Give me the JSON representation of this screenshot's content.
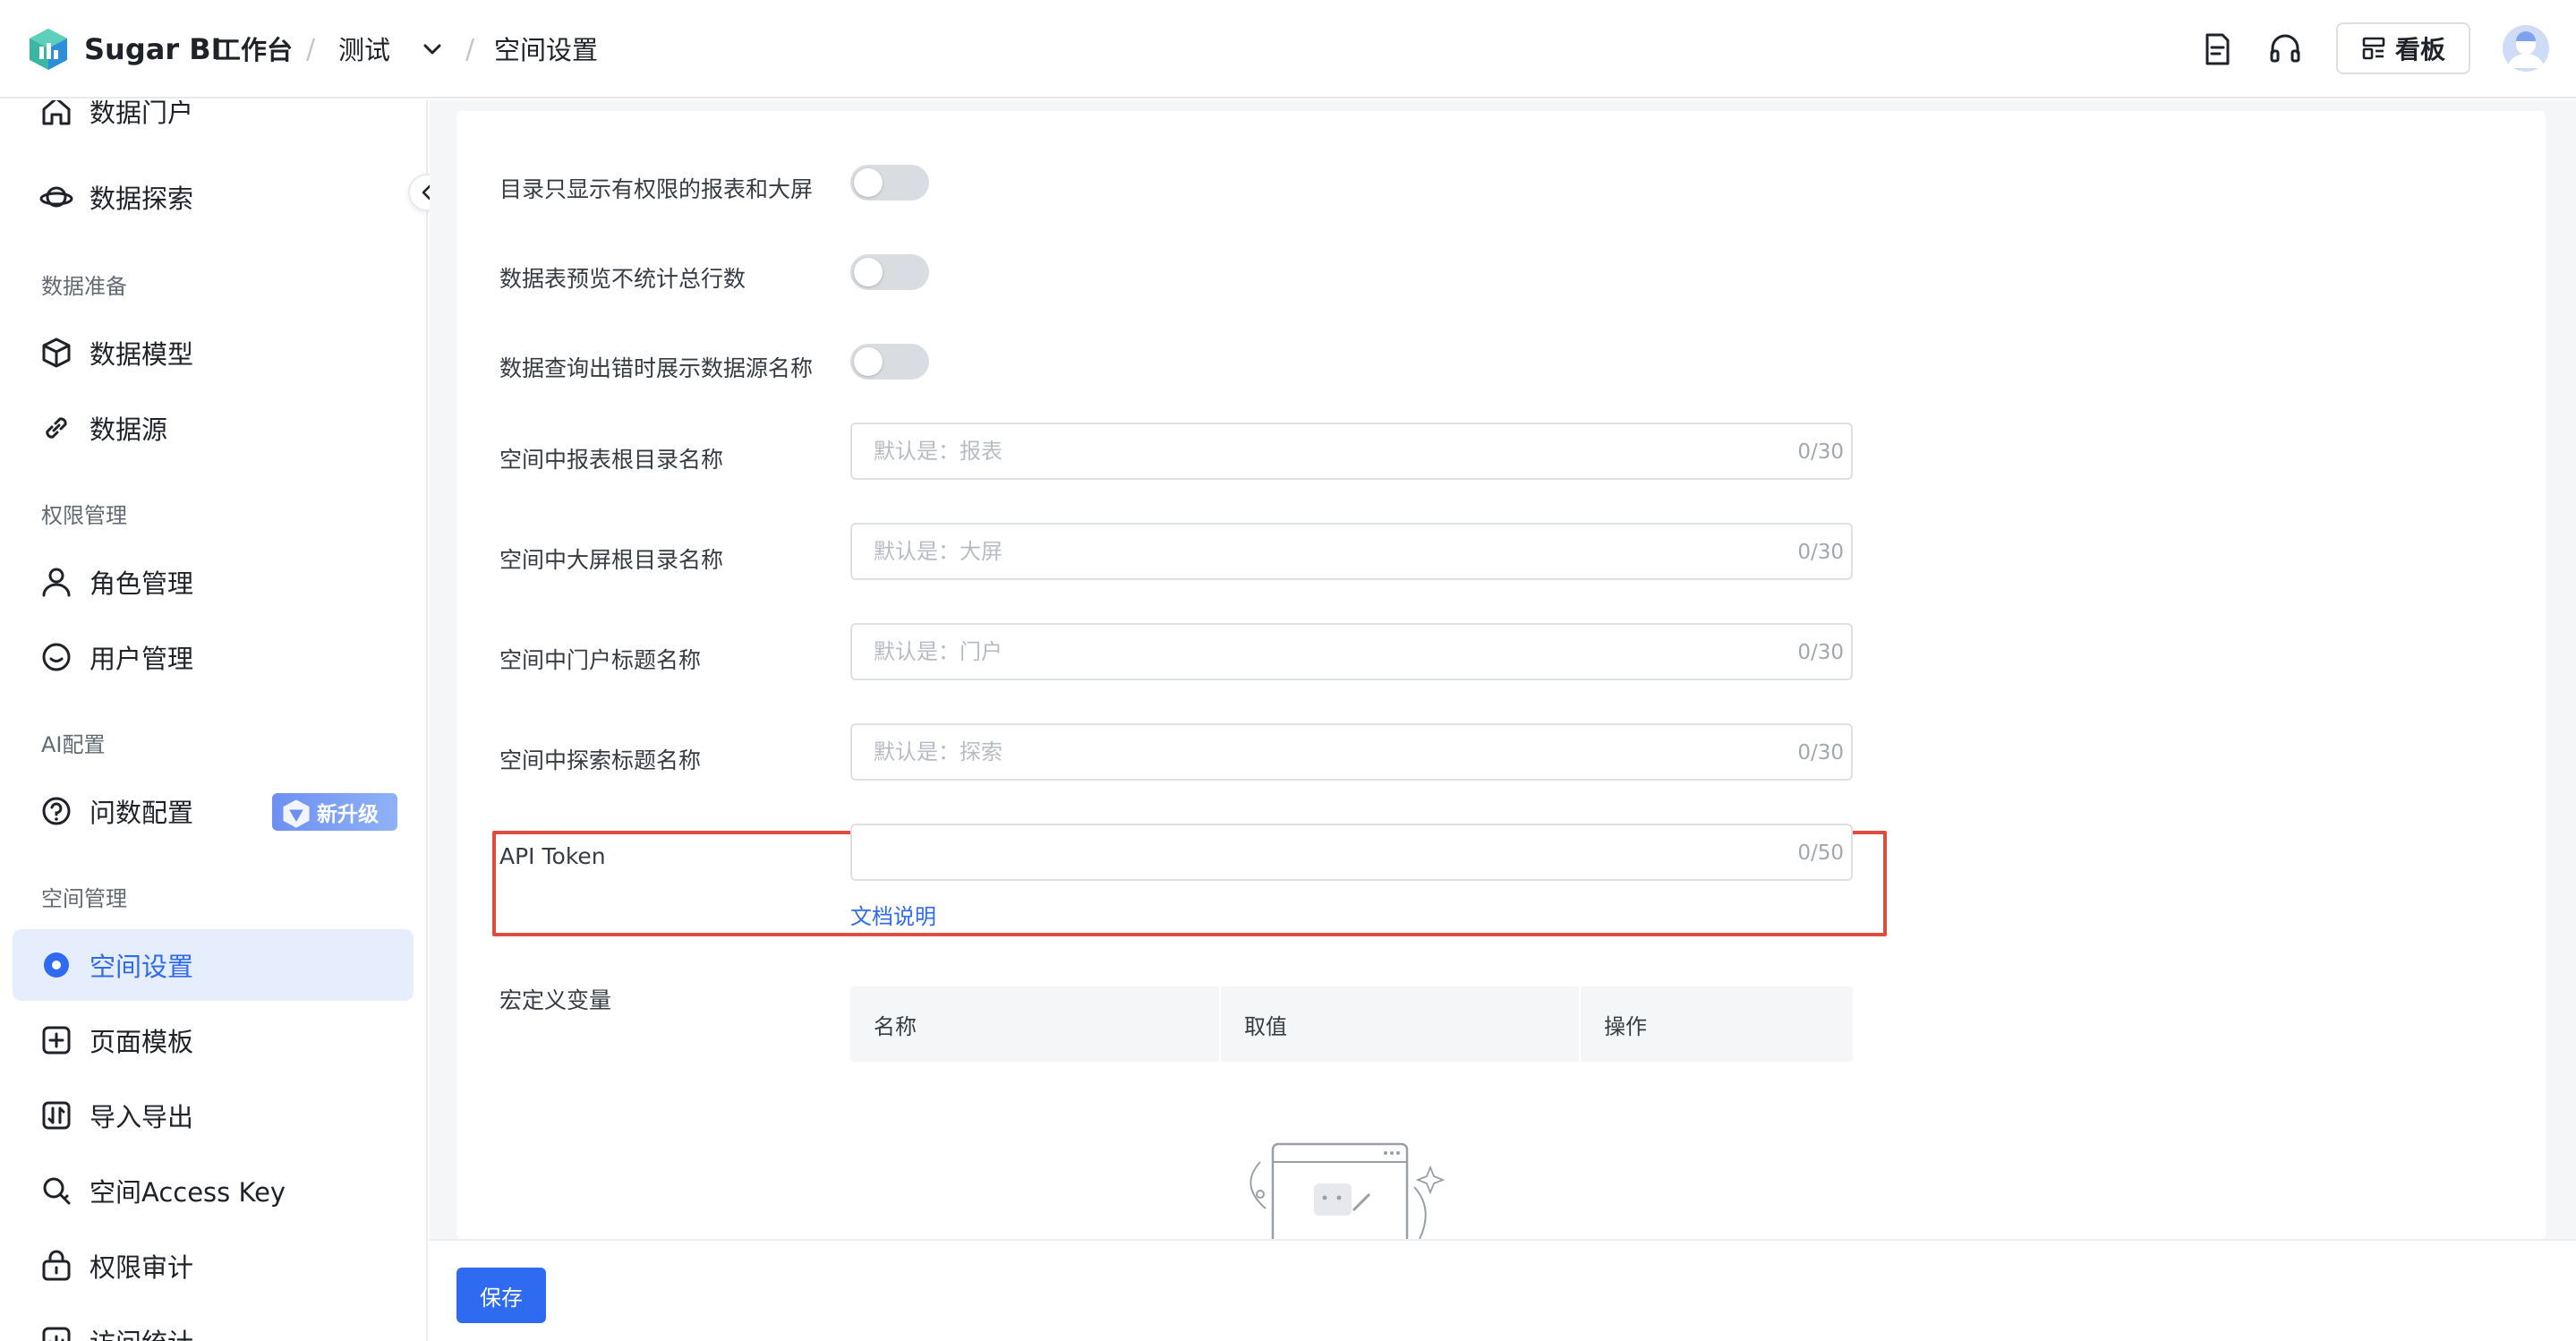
{
  "header": {
    "brand": "Sugar BI",
    "workbench": "工作台",
    "separator": "/",
    "workspace": "测试",
    "page": "空间设置",
    "board_label": "看板"
  },
  "sidebar": {
    "items": [
      {
        "label": "数据门户",
        "icon": "home-icon"
      },
      {
        "label": "数据探索",
        "icon": "planet-icon"
      },
      {
        "group": "数据准备"
      },
      {
        "label": "数据模型",
        "icon": "cube-icon"
      },
      {
        "label": "数据源",
        "icon": "link-icon"
      },
      {
        "group": "权限管理"
      },
      {
        "label": "角色管理",
        "icon": "user-icon"
      },
      {
        "label": "用户管理",
        "icon": "user-circle-icon"
      },
      {
        "group": "AI配置"
      },
      {
        "label": "问数配置",
        "icon": "question-icon",
        "badge": "新升级"
      },
      {
        "group": "空间管理"
      },
      {
        "label": "空间设置",
        "icon": "settings-icon",
        "active": true
      },
      {
        "label": "页面模板",
        "icon": "template-icon"
      },
      {
        "label": "导入导出",
        "icon": "import-export-icon"
      },
      {
        "label": "空间Access Key",
        "icon": "key-icon"
      },
      {
        "label": "权限审计",
        "icon": "audit-icon"
      },
      {
        "label": "访问统计",
        "icon": "stats-icon"
      }
    ]
  },
  "settings": {
    "toggles": [
      {
        "label": "目录只显示有权限的报表和大屏",
        "on": false
      },
      {
        "label": "数据表预览不统计总行数",
        "on": false
      },
      {
        "label": "数据查询出错时展示数据源名称",
        "on": false
      }
    ],
    "inputs": [
      {
        "label": "空间中报表根目录名称",
        "placeholder": "默认是：报表",
        "value": "",
        "counter": "0/30"
      },
      {
        "label": "空间中大屏根目录名称",
        "placeholder": "默认是：大屏",
        "value": "",
        "counter": "0/30"
      },
      {
        "label": "空间中门户标题名称",
        "placeholder": "默认是：门户",
        "value": "",
        "counter": "0/30"
      },
      {
        "label": "空间中探索标题名称",
        "placeholder": "默认是：探索",
        "value": "",
        "counter": "0/30"
      }
    ],
    "api_token": {
      "label": "API Token",
      "value": "",
      "counter": "0/50",
      "doc_link": "文档说明"
    },
    "macro": {
      "label": "宏定义变量",
      "columns": [
        "名称",
        "取值",
        "操作"
      ]
    }
  },
  "footer": {
    "save_label": "保存"
  },
  "colors": {
    "accent": "#2f6bf0",
    "highlight": "#dd4c3d",
    "active_bg": "#e6eefd"
  }
}
